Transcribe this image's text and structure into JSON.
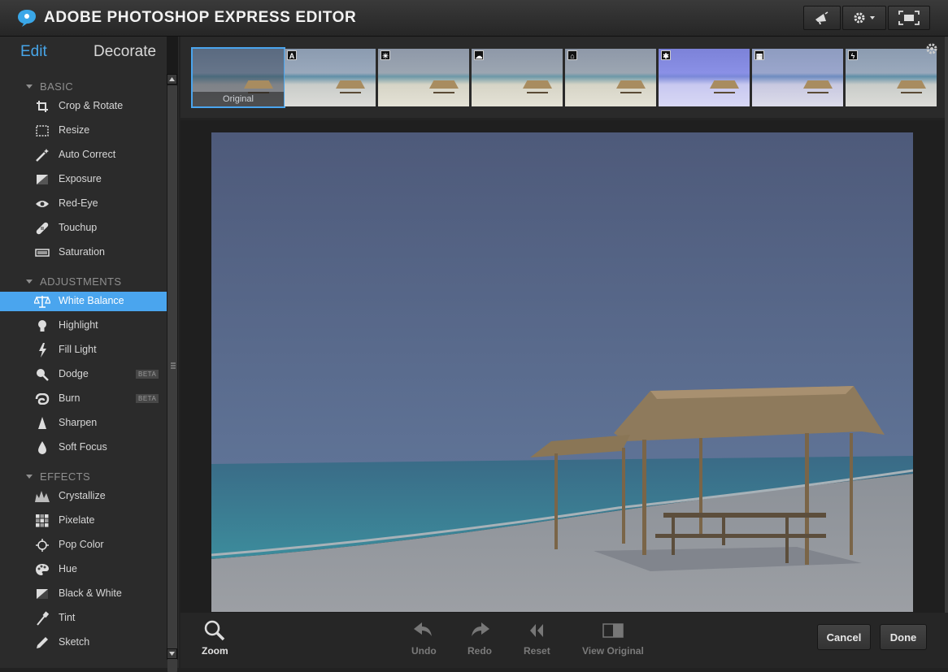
{
  "app": {
    "title": "ADOBE PHOTOSHOP EXPRESS EDITOR",
    "icons": [
      "megaphone-icon",
      "gear-icon",
      "fullscreen-icon"
    ]
  },
  "sidebar": {
    "tabs": {
      "edit": "Edit",
      "decorate": "Decorate"
    },
    "sections": [
      {
        "name": "BASIC",
        "items": [
          {
            "label": "Crop & Rotate",
            "icon": "crop-icon"
          },
          {
            "label": "Resize",
            "icon": "resize-icon"
          },
          {
            "label": "Auto Correct",
            "icon": "magic-wand-icon"
          },
          {
            "label": "Exposure",
            "icon": "exposure-icon"
          },
          {
            "label": "Red-Eye",
            "icon": "eye-icon"
          },
          {
            "label": "Touchup",
            "icon": "bandage-icon"
          },
          {
            "label": "Saturation",
            "icon": "saturation-icon"
          }
        ]
      },
      {
        "name": "ADJUSTMENTS",
        "items": [
          {
            "label": "White Balance",
            "icon": "scales-icon",
            "selected": true
          },
          {
            "label": "Highlight",
            "icon": "lightbulb-icon"
          },
          {
            "label": "Fill Light",
            "icon": "lightning-icon"
          },
          {
            "label": "Dodge",
            "icon": "dodge-icon",
            "badge": "BETA"
          },
          {
            "label": "Burn",
            "icon": "burn-icon",
            "badge": "BETA"
          },
          {
            "label": "Sharpen",
            "icon": "sharpen-icon"
          },
          {
            "label": "Soft Focus",
            "icon": "drop-icon"
          }
        ]
      },
      {
        "name": "EFFECTS",
        "items": [
          {
            "label": "Crystallize",
            "icon": "crystallize-icon"
          },
          {
            "label": "Pixelate",
            "icon": "pixelate-icon"
          },
          {
            "label": "Pop Color",
            "icon": "target-icon"
          },
          {
            "label": "Hue",
            "icon": "palette-icon"
          },
          {
            "label": "Black & White",
            "icon": "black-white-icon"
          },
          {
            "label": "Tint",
            "icon": "dropper-icon"
          },
          {
            "label": "Sketch",
            "icon": "pencil-icon"
          }
        ]
      }
    ]
  },
  "filmstrip": {
    "thumbnails": [
      {
        "label": "Original",
        "badge": "",
        "selected": true
      },
      {
        "label": "",
        "badge": "A"
      },
      {
        "label": "",
        "badge": "☀"
      },
      {
        "label": "",
        "badge": "☁"
      },
      {
        "label": "",
        "badge": "⌂"
      },
      {
        "label": "",
        "badge": "✱"
      },
      {
        "label": "",
        "badge": "▦"
      },
      {
        "label": "",
        "badge": "ϟ"
      }
    ]
  },
  "bottombar": {
    "zoom": "Zoom",
    "undo": "Undo",
    "redo": "Redo",
    "reset": "Reset",
    "view_original": "View Original",
    "cancel": "Cancel",
    "done": "Done"
  },
  "colors": {
    "accent": "#4aa5ee",
    "background": "#222222",
    "sidebar": "#2b2b2b"
  }
}
